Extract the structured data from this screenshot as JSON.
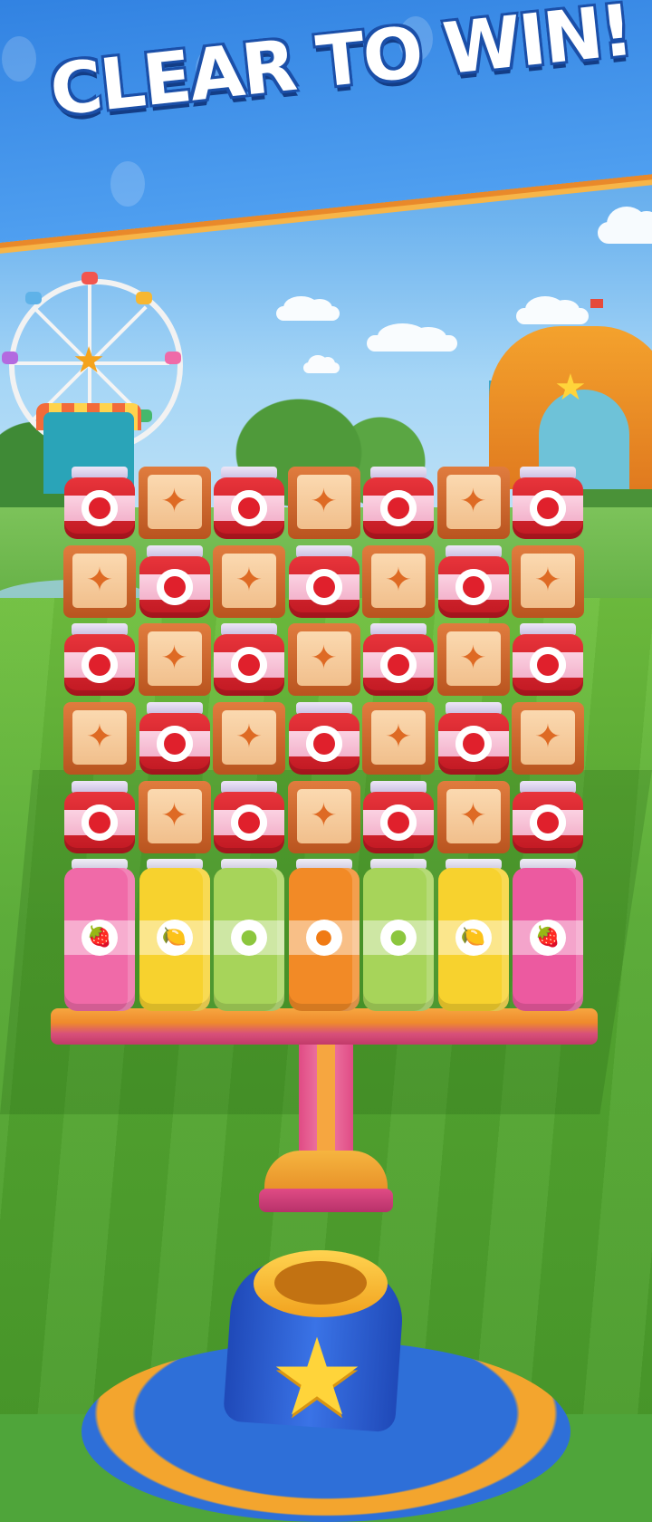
{
  "banner": {
    "title": "CLEAR TO WIN!"
  },
  "colors": {
    "banner_blue": "#2e7fe0",
    "banner_stripe": "#e9892a",
    "jar_red": "#e8343b",
    "crate_orange": "#e07c3e",
    "grass_green": "#56a932"
  },
  "board": {
    "columns": 7,
    "rows": [
      [
        "jam-jar",
        "crate",
        "jam-jar",
        "crate",
        "jam-jar",
        "crate",
        "jam-jar"
      ],
      [
        "crate",
        "jam-jar",
        "crate",
        "jam-jar",
        "crate",
        "jam-jar",
        "crate"
      ],
      [
        "jam-jar",
        "crate",
        "jam-jar",
        "crate",
        "jam-jar",
        "crate",
        "jam-jar"
      ],
      [
        "crate",
        "jam-jar",
        "crate",
        "jam-jar",
        "crate",
        "jam-jar",
        "crate"
      ],
      [
        "jam-jar",
        "crate",
        "jam-jar",
        "crate",
        "jam-jar",
        "crate",
        "jam-jar"
      ]
    ],
    "bottom_jars": [
      {
        "fruit": "strawberry",
        "icon": "strawberry-icon",
        "color": "#f06aa8"
      },
      {
        "fruit": "lemon",
        "icon": "lemon-icon",
        "color": "#f7d22e"
      },
      {
        "fruit": "lime",
        "icon": "lime-icon",
        "color": "#a7d45a"
      },
      {
        "fruit": "orange",
        "icon": "orange-icon",
        "color": "#f28a26"
      },
      {
        "fruit": "lime",
        "icon": "lime-icon",
        "color": "#a7d45a"
      },
      {
        "fruit": "lemon",
        "icon": "lemon-icon",
        "color": "#f7d22e"
      },
      {
        "fruit": "strawberry",
        "icon": "strawberry-icon",
        "color": "#ec5aa0"
      }
    ]
  },
  "cannon": {
    "icon": "star-icon"
  }
}
